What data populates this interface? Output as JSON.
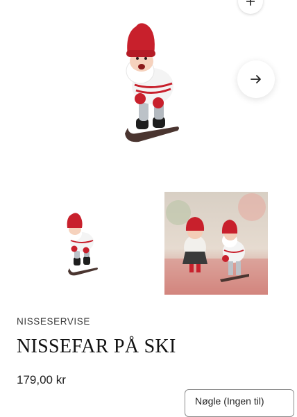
{
  "gallery": {
    "zoom_icon": "plus-icon",
    "next_icon": "arrow-right-icon",
    "main_image_alt": "",
    "thumbnails": [
      {
        "icon": "product-thumbnail"
      },
      {
        "icon": "lifestyle-thumbnail"
      }
    ]
  },
  "product": {
    "brand": "NISSESERVISE",
    "title": "NISSEFAR PÅ SKI",
    "price": "179,00 kr"
  },
  "variant_select": {
    "value": "Nøgle (Ingen til)"
  },
  "colors": {
    "hat_red": "#c8202c",
    "background": "#ffffff",
    "text": "#111111"
  }
}
